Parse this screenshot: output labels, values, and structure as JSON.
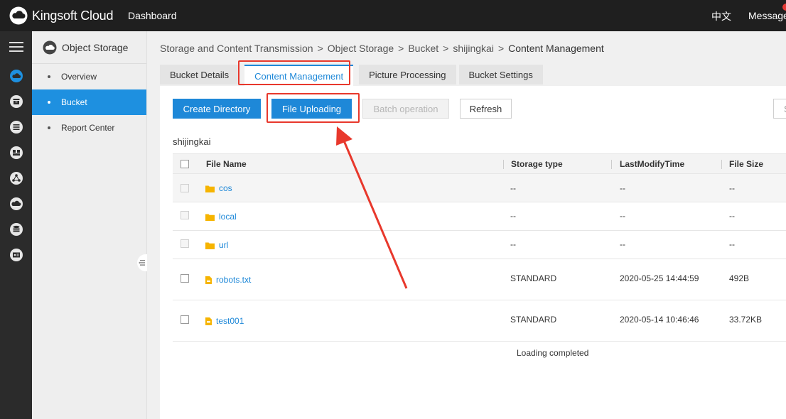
{
  "topbar": {
    "brand": "Kingsoft Cloud",
    "dashboard": "Dashboard",
    "language": "中文",
    "message": "Message"
  },
  "rail_icons": [
    "menu-icon",
    "cloud-storage-icon",
    "box-icon",
    "list-icon",
    "chat-icon",
    "network-icon",
    "cloud-icon",
    "database-icon",
    "id-card-icon"
  ],
  "sidebar": {
    "title": "Object Storage",
    "items": [
      {
        "label": "Overview",
        "active": false
      },
      {
        "label": "Bucket",
        "active": true
      },
      {
        "label": "Report Center",
        "active": false
      }
    ]
  },
  "breadcrumb": [
    "Storage and Content Transmission",
    "Object Storage",
    "Bucket",
    "shijingkai",
    "Content Management"
  ],
  "tabs": [
    {
      "label": "Bucket Details"
    },
    {
      "label": "Content Management",
      "active": true
    },
    {
      "label": "Picture Processing"
    },
    {
      "label": "Bucket Settings"
    }
  ],
  "toolbar": {
    "create_directory": "Create Directory",
    "file_uploading": "File Uploading",
    "batch_operation": "Batch operation",
    "refresh": "Refresh",
    "search_partial": "S"
  },
  "bucket_name": "shijingkai",
  "table": {
    "columns": [
      "File Name",
      "Storage type",
      "LastModifyTime",
      "File Size"
    ],
    "rows": [
      {
        "type": "folder",
        "name": "cos",
        "storage": "--",
        "modified": "--",
        "size": "--"
      },
      {
        "type": "folder",
        "name": "local",
        "storage": "--",
        "modified": "--",
        "size": "--"
      },
      {
        "type": "folder",
        "name": "url",
        "storage": "--",
        "modified": "--",
        "size": "--"
      },
      {
        "type": "file",
        "name": "robots.txt",
        "storage": "STANDARD",
        "modified": "2020-05-25 14:44:59",
        "size": "492B"
      },
      {
        "type": "file",
        "name": "test001",
        "storage": "STANDARD",
        "modified": "2020-05-14 10:46:46",
        "size": "33.72KB"
      }
    ]
  },
  "status": "Loading completed",
  "colors": {
    "accent": "#1e88d8",
    "annotation": "#e8382c",
    "folder": "#f6b400"
  }
}
